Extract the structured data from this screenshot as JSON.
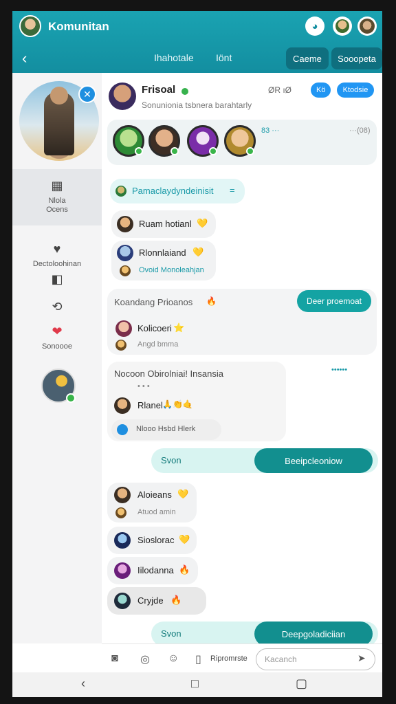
{
  "app": {
    "title": "Komunitan",
    "tabs": [
      "Ihahotale",
      "Iönt"
    ],
    "actions": [
      "Caeme",
      "Sooopeta"
    ]
  },
  "sidebar": {
    "items": [
      {
        "label": "Nlola\nOcens",
        "icon": "calendar-icon"
      },
      {
        "label": "Dectoloohinan",
        "icon": "heart-icon"
      },
      {
        "label": "",
        "icon": "apps-icon"
      },
      {
        "label": "",
        "icon": "swap-icon"
      },
      {
        "label": "Sonoooe",
        "icon": "heart-red-icon"
      }
    ]
  },
  "chat": {
    "header": {
      "name": "Frisoal",
      "subtitle": "Sonunionia tsbnera barahtarly",
      "meta": "ØR ıØ",
      "badges": [
        "Kö",
        "Ktodsie"
      ]
    },
    "members_meta": "83 ···",
    "members_count": "···(08)",
    "messages": [
      {
        "type": "mention",
        "text": "Pamaclaydyndeinisit",
        "suffix": "="
      },
      {
        "type": "msg",
        "text": "Ruam hotianl",
        "emoji": "💛"
      },
      {
        "type": "msg",
        "text": "Rlonnlaiand",
        "emoji": "💛",
        "sub": "Ovoid Monoleahjan"
      },
      {
        "type": "card",
        "text": "Koandang Prioanos",
        "emoji": "🔥",
        "button": "Deer proemoat",
        "name": "Kolicoeri",
        "name_emoji": "⭐",
        "sub": "Angd bmma"
      },
      {
        "type": "card2",
        "title": "Nocoon Obirolniai! Insansia",
        "dots": "• • •",
        "name": "Rlanel",
        "emojis": "🙏👏🤙",
        "sub": "Nlooo Hsbd Hlerk",
        "status": "••••••"
      },
      {
        "type": "send",
        "left": "Svon",
        "right": "Beeipcleoniow"
      },
      {
        "type": "msg",
        "text": "Aloieans",
        "emoji": "💛",
        "sub": "Atuod amin"
      },
      {
        "type": "msg",
        "text": "Sioslorac",
        "emoji": "💛"
      },
      {
        "type": "msg",
        "text": "Iilodanna",
        "emoji": "🔥"
      },
      {
        "type": "msg",
        "text": "Cryjde",
        "emoji": "🔥"
      },
      {
        "type": "send",
        "left": "Svon",
        "right": "Deepgoladiciian"
      }
    ]
  },
  "composer": {
    "label": "Ripromrste",
    "placeholder": "Kacanch"
  }
}
